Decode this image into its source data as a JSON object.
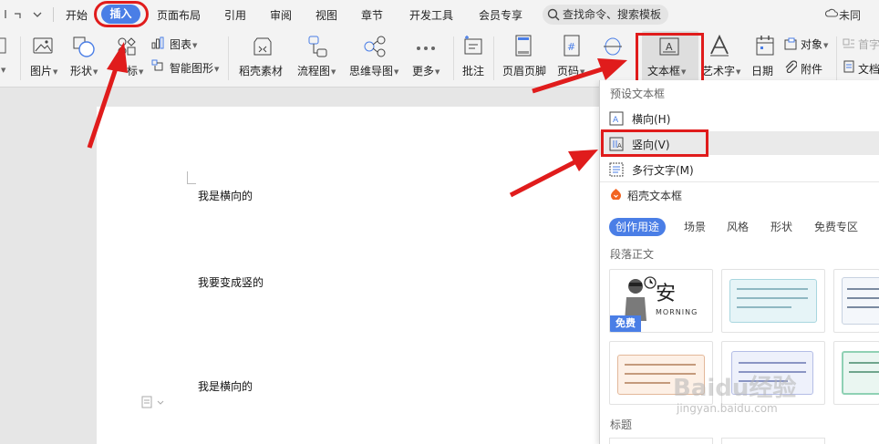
{
  "menubar": {
    "tabs": [
      "开始",
      "插入",
      "页面布局",
      "引用",
      "审阅",
      "视图",
      "章节",
      "开发工具",
      "会员专享"
    ],
    "search_placeholder": "查找命令、搜索模板",
    "sync_status": "未同"
  },
  "ribbon": {
    "picture": "图片",
    "shape": "形状",
    "icon": "标",
    "chart": "图表",
    "smart_graphic": "智能图形",
    "docer_material": "稻壳素材",
    "flowchart": "流程图",
    "mindmap": "思维导图",
    "more": "更多",
    "comment": "批注",
    "header_footer": "页眉页脚",
    "page_number": "页码",
    "textbox": "文本框",
    "wordart": "艺术字",
    "date": "日期",
    "object": "对象",
    "first_letter": "首字",
    "attachment": "附件",
    "document": "文档"
  },
  "document": {
    "lines": [
      "我是横向的",
      "我要变成竖的",
      "我是横向的"
    ]
  },
  "dropdown": {
    "preset_header": "预设文本框",
    "items": [
      {
        "label": "横向(H)",
        "icon": "horizontal-textbox-icon"
      },
      {
        "label": "竖向(V)",
        "icon": "vertical-textbox-icon"
      },
      {
        "label": "多行文字(M)",
        "icon": "multiline-text-icon"
      }
    ],
    "docer_header": "稻壳文本框",
    "categories": [
      "创作用途",
      "场景",
      "风格",
      "形状",
      "免费专区"
    ],
    "section_paragraph": "段落正文",
    "section_title": "标题",
    "thumb1_text": "安",
    "thumb1_sub": "MORNING",
    "free_badge": "免费"
  },
  "watermark": {
    "brand": "Baidu经验",
    "url": "jingyan.baidu.com"
  },
  "colors": {
    "accent": "#4a7ee6",
    "annotation": "#e01c1c"
  }
}
